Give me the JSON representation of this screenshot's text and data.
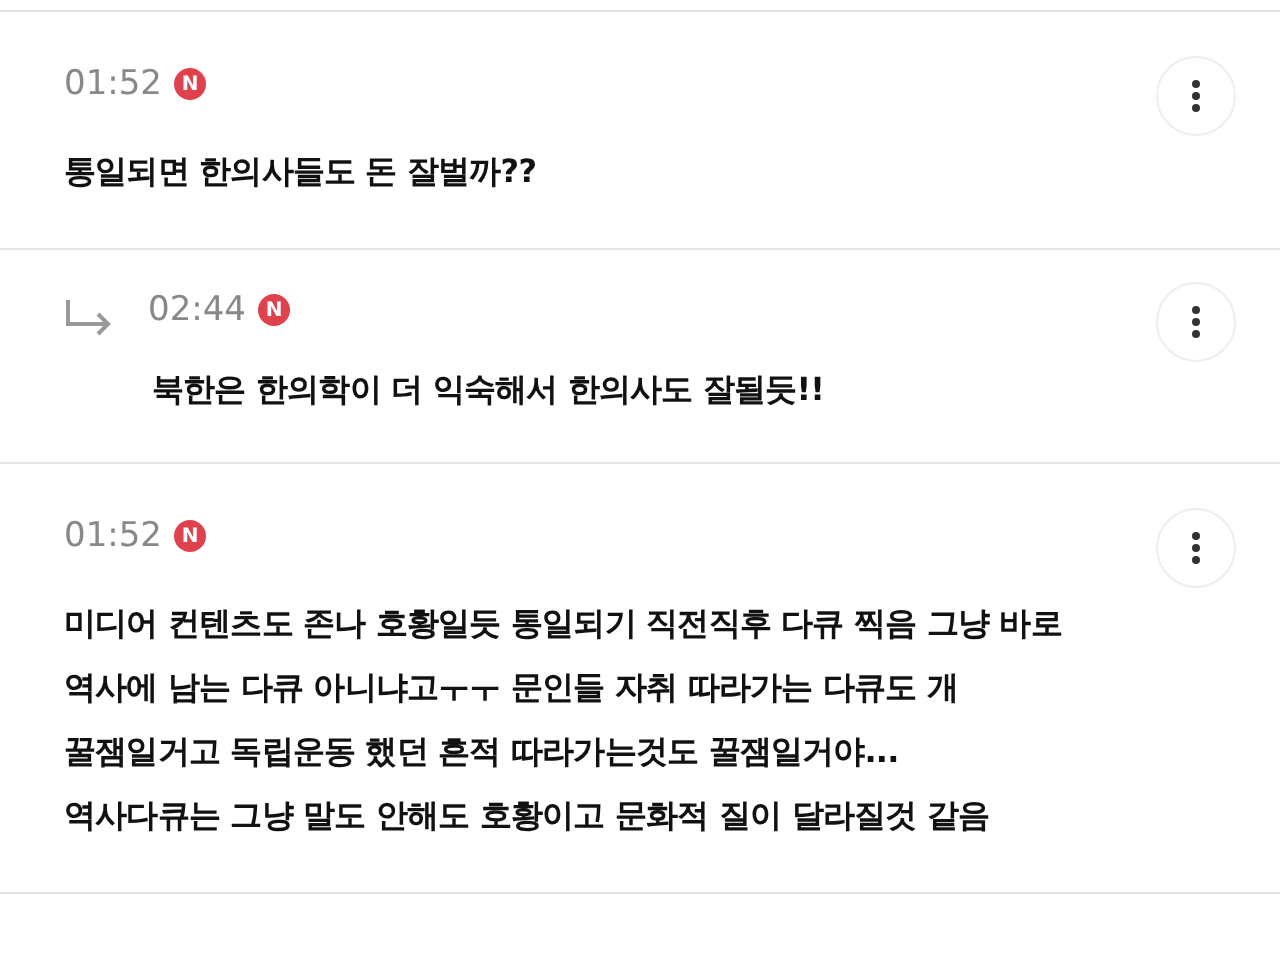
{
  "comments": [
    {
      "kind": "comment",
      "time": "01:52",
      "badge": "N",
      "text": "통일되면 한의사들도 돈 잘벌까??"
    },
    {
      "kind": "reply",
      "time": "02:44",
      "badge": "N",
      "text": "북한은 한의학이 더 익숙해서 한의사도 잘될듯!!"
    },
    {
      "kind": "comment",
      "time": "01:52",
      "badge": "N",
      "text": "미디어 컨텐츠도 존나 호황일듯 통일되기 직전직후 다큐 찍음 그냥 바로\n역사에 남는 다큐 아니냐고ㅜㅜ 문인들 자취 따라가는 다큐도 개\n꿀잼일거고 독립운동 했던 흔적 따라가는것도 꿀잼일거야...\n역사다큐는 그냥 말도 안해도 호황이고 문화적 질이 달라질것 같음"
    }
  ]
}
